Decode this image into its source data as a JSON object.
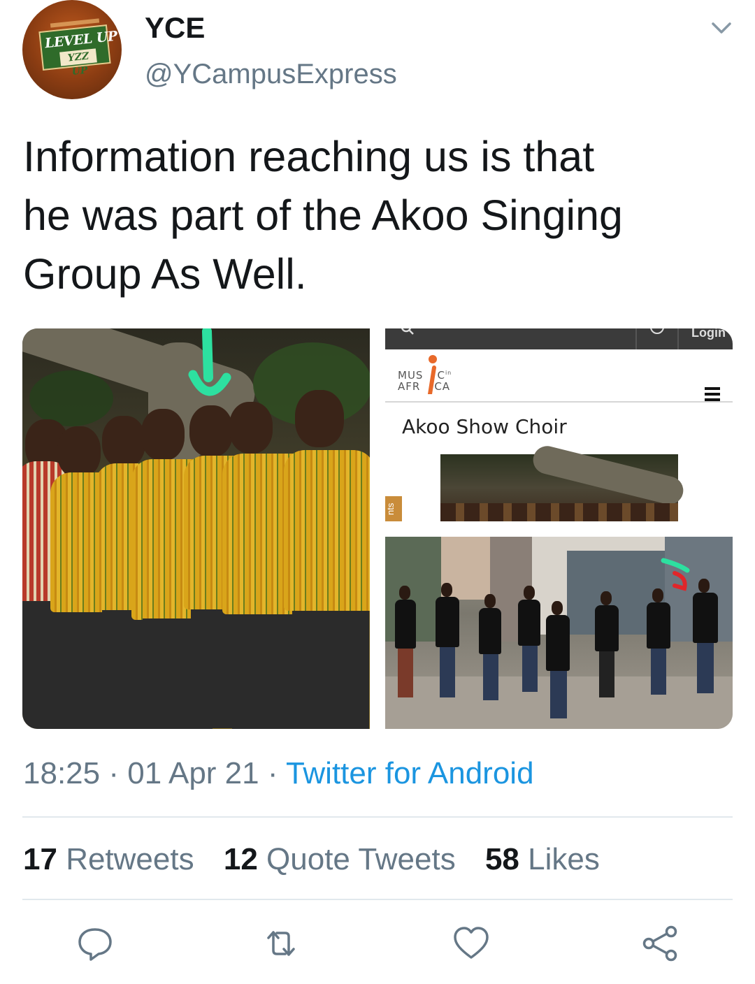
{
  "tweet": {
    "display_name": "YCE",
    "handle": "@YCampusExpress",
    "text_lines": [
      "Information reaching us is that",
      "he was part of the Akoo Singing",
      "Group As Well."
    ],
    "time": "18:25",
    "date": "01 Apr 21",
    "source": "Twitter for Android",
    "separator": "·"
  },
  "avatar": {
    "line1": "LEVEL UP",
    "line2": "YZZ UP"
  },
  "media": {
    "embedded_site": {
      "logo_text": [
        "MUS",
        "C",
        "AFR",
        "CA"
      ],
      "logo_superscript": "in",
      "login_label": "Login",
      "page_title": "Akoo Show Choir",
      "side_tab": "nts"
    }
  },
  "stats": {
    "retweets_count": "17",
    "retweets_label": "Retweets",
    "quotes_count": "12",
    "quotes_label": "Quote Tweets",
    "likes_count": "58",
    "likes_label": "Likes"
  },
  "actions": [
    {
      "name": "reply",
      "icon": "reply-icon"
    },
    {
      "name": "retweet",
      "icon": "retweet-icon"
    },
    {
      "name": "like",
      "icon": "heart-icon"
    },
    {
      "name": "share",
      "icon": "share-icon"
    }
  ],
  "colors": {
    "text_primary": "#14171a",
    "text_secondary": "#657786",
    "link": "#1b95e0",
    "divider": "#e1e8ed",
    "arrow_annotation": "#2de0a0",
    "arrow_annotation_red": "#e0262a"
  }
}
